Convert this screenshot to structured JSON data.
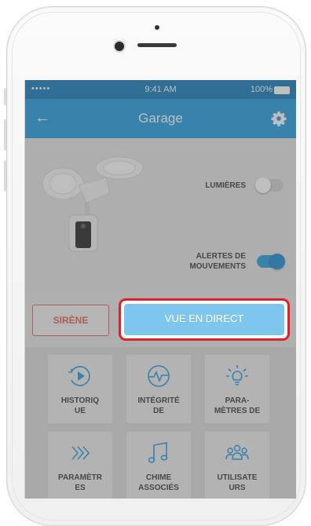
{
  "status_bar": {
    "signal": "•••••",
    "time": "9:41 AM",
    "battery": "100%"
  },
  "nav": {
    "back_icon": "back-arrow-icon",
    "title": "Garage",
    "settings_icon": "gear-icon"
  },
  "toggles": [
    {
      "label": "LUMIÈRES",
      "state": "off"
    },
    {
      "label": "ALERTES DE\nMOUVEMENTS",
      "state": "on"
    }
  ],
  "actions": {
    "siren_label": "SIRÈNE",
    "live_label": "VUE EN DIRECT"
  },
  "tiles": [
    {
      "icon": "play-circle-icon",
      "label": "HISTORIQ\nUE"
    },
    {
      "icon": "health-pulse-icon",
      "label": "INTÉGRITÉ\nDE"
    },
    {
      "icon": "light-bulb-icon",
      "label": "PARA-\nMÈTRES DE"
    },
    {
      "icon": "motion-chevrons-icon",
      "label": "PARAMÈTR\nES"
    },
    {
      "icon": "music-note-icon",
      "label": "CHIME\nASSOCIÉS"
    },
    {
      "icon": "users-group-icon",
      "label": "UTILISATE\nURS"
    }
  ],
  "colors": {
    "brand_blue": "#1998e1",
    "status_blue": "#0c76b8",
    "live_button": "#7fc6ee",
    "highlight_red": "#e0202b",
    "siren_red": "#e15a4f"
  }
}
